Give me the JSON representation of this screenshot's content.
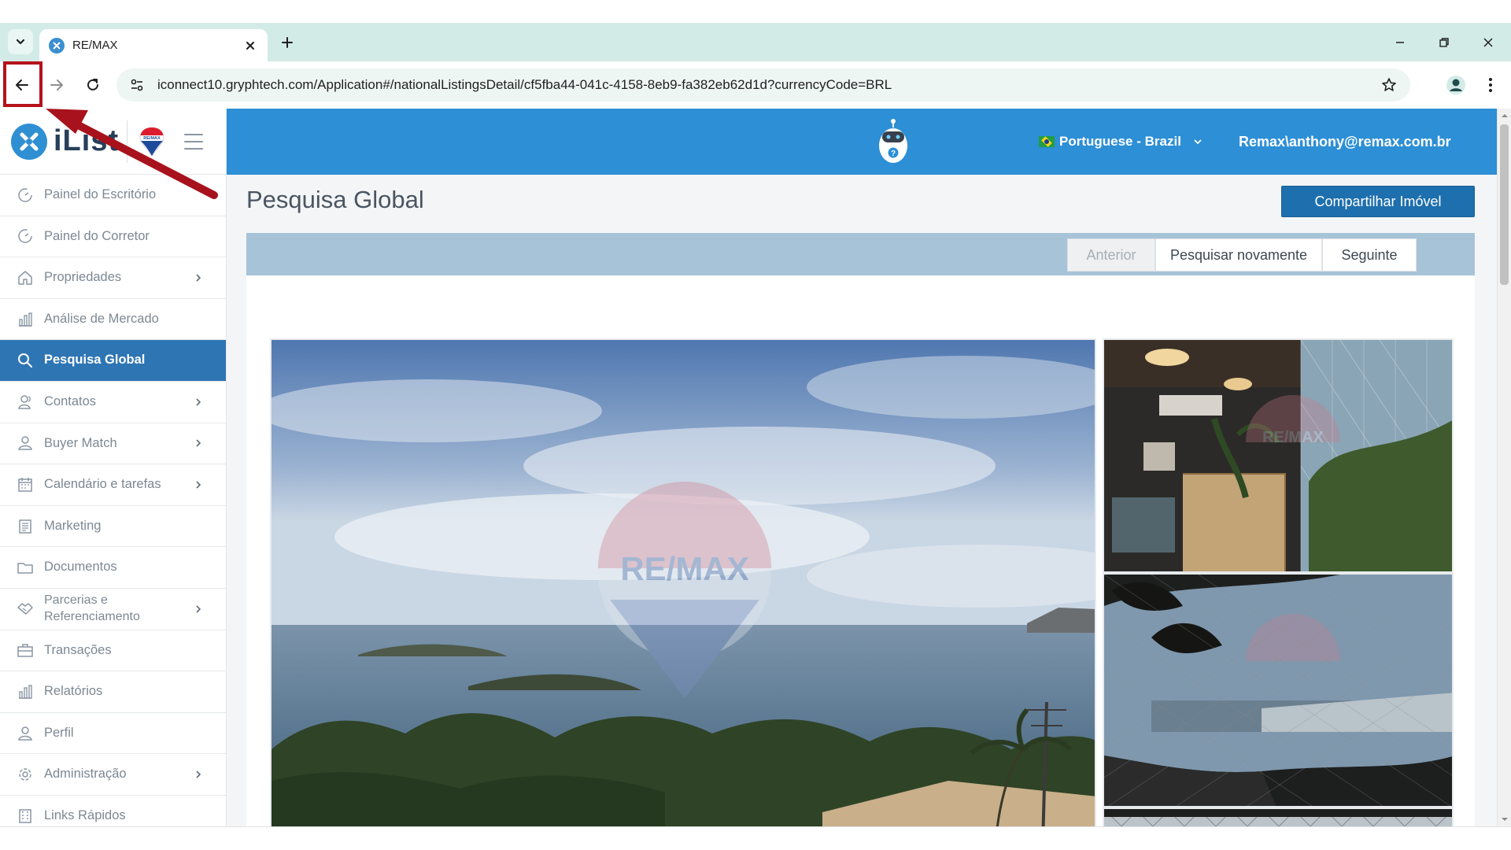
{
  "browser": {
    "tab_title": "RE/MAX",
    "url": "iconnect10.gryphtech.com/Application#/nationalListingsDetail/cf5fba44-041c-4158-8eb9-fa382eb62d1d?currencyCode=BRL"
  },
  "brand": {
    "name": "iList",
    "balloon_text": "RE/MAX"
  },
  "header": {
    "language": "Portuguese - Brazil",
    "user": "Remax\\anthony@remax.com.br"
  },
  "sidebar": {
    "items": [
      {
        "label": "Painel do Escritório",
        "icon": "gauge-icon",
        "chevron": false
      },
      {
        "label": "Painel do Corretor",
        "icon": "gauge-icon",
        "chevron": false
      },
      {
        "label": "Propriedades",
        "icon": "home-icon",
        "chevron": true
      },
      {
        "label": "Análise de Mercado",
        "icon": "bar-chart-icon",
        "chevron": false
      },
      {
        "label": "Pesquisa Global",
        "icon": "search-icon",
        "chevron": false,
        "active": true
      },
      {
        "label": "Contatos",
        "icon": "users-icon",
        "chevron": true
      },
      {
        "label": "Buyer Match",
        "icon": "user-icon",
        "chevron": true
      },
      {
        "label": "Calendário e tarefas",
        "icon": "calendar-icon",
        "chevron": true
      },
      {
        "label": "Marketing",
        "icon": "newspaper-icon",
        "chevron": false
      },
      {
        "label": "Documentos",
        "icon": "folder-icon",
        "chevron": false
      },
      {
        "label": "Parcerias e",
        "label2": "Referenciamento",
        "icon": "handshake-icon",
        "chevron": true
      },
      {
        "label": "Transações",
        "icon": "briefcase-icon",
        "chevron": false
      },
      {
        "label": "Relatórios",
        "icon": "bar-chart-icon",
        "chevron": false
      },
      {
        "label": "Perfil",
        "icon": "user-icon",
        "chevron": false
      },
      {
        "label": "Administração",
        "icon": "gear-icon",
        "chevron": true
      },
      {
        "label": "Links Rápidos",
        "icon": "building-icon",
        "chevron": false
      }
    ]
  },
  "main": {
    "title": "Pesquisa Global",
    "share_button": "Compartilhar Imóvel",
    "toolbar": {
      "prev": "Anterior",
      "search_again": "Pesquisar novamente",
      "next": "Seguinte"
    },
    "watermark": "RE/MAX"
  },
  "colors": {
    "accent": "#2d8fd5",
    "active_nav": "#2e75b3",
    "share_button": "#1d6fae",
    "highlight": "#b5121b"
  }
}
